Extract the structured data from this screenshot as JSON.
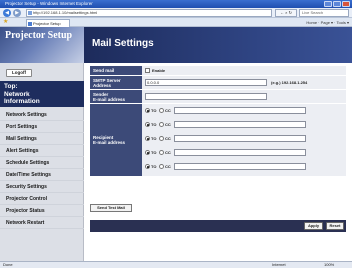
{
  "window": {
    "title": "Projector Setup - Windows Internet Explorer"
  },
  "address_bar": {
    "url": "http://192.168.1.10/mailsettings.html",
    "refresh_label": "← × ↻",
    "search_placeholder": "Live Search"
  },
  "tab_bar": {
    "tab_label": "Projector Setup",
    "tools_label": "Home · Page ▾ · Tools ▾"
  },
  "sidebar": {
    "logo": "Projector Setup",
    "logoff_label": "Logoff",
    "top_line1": "Top:",
    "top_line2": "Network",
    "top_line3": "Information",
    "items": [
      {
        "label": "Network Settings"
      },
      {
        "label": "Port Settings"
      },
      {
        "label": "Mail Settings"
      },
      {
        "label": "Alert Settings"
      },
      {
        "label": "Schedule Settings"
      },
      {
        "label": "Date/Time Settings"
      },
      {
        "label": "Security Settings"
      },
      {
        "label": "Projector Control"
      },
      {
        "label": "Projector Status"
      },
      {
        "label": "Network Restart"
      }
    ]
  },
  "main": {
    "title": "Mail Settings",
    "send_mail_label": "Send mail",
    "enable_label": "Enable",
    "smtp_label_1": "SMTP Server",
    "smtp_label_2": "Address",
    "smtp_value": "0.0.0.0",
    "smtp_hint": "(e.g.) 192.168.1.254",
    "sender_label_1": "Sender",
    "sender_label_2": "E-mail address",
    "sender_value": "",
    "recipient_label_1": "Recipient",
    "recipient_label_2": "E-mail address",
    "to_label": "TO",
    "cc_label": "CC",
    "send_test_label": "Send Test Mail",
    "apply_label": "Apply",
    "reset_label": "Reset"
  },
  "statusbar": {
    "left": "Done",
    "zone": "Internet",
    "zoom": "100%"
  },
  "colors": {
    "header_navy": "#1d2b5b",
    "label_bg": "#3c4a78",
    "sidebar_bg": "#dcdfe6"
  }
}
